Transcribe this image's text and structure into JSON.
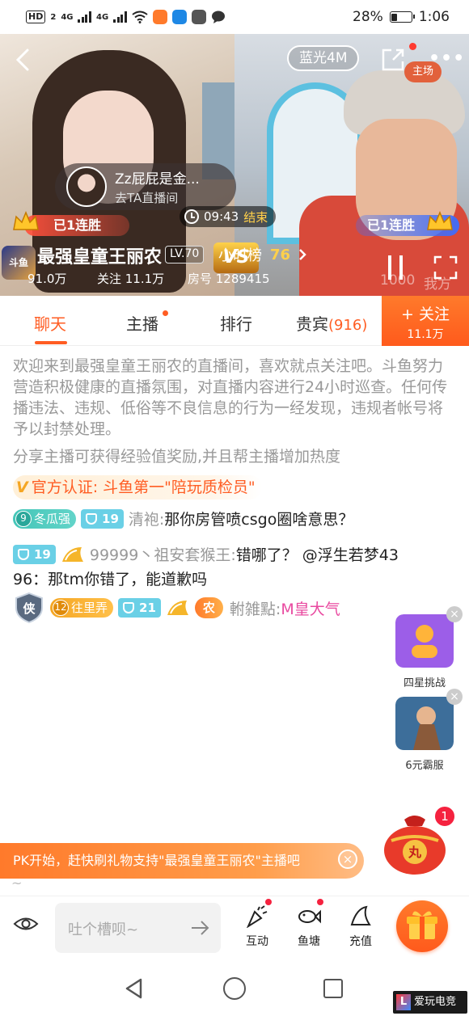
{
  "status_bar": {
    "network_badge": "HD",
    "network_sub": "2",
    "sig1": "4G",
    "sig2": "4G",
    "battery": "28%",
    "time": "1:06"
  },
  "video": {
    "quality": "蓝光4M",
    "host_badge": "主场",
    "guest_name": "Zz屁屁是金...",
    "guest_sub": "去TA直播间",
    "pk_time": "09:43",
    "pk_state": "结束",
    "streak_left": "已1连胜",
    "streak_right": "已1连胜",
    "vs": "VS",
    "logo_text": "斗鱼",
    "anchor_name": "最强皇童王丽农",
    "level": "LV.70",
    "hour_rank_label": "小时榜",
    "hour_rank_value": "76",
    "fans": "91.0万",
    "follow_label": "关注 11.1万",
    "room_label": "房号 1289415",
    "right_count": "1000",
    "right_me": "我方"
  },
  "tabs": {
    "chat": "聊天",
    "anchor": "主播",
    "rank": "排行",
    "vip": "贵宾",
    "vip_count": "(916)"
  },
  "follow_button": {
    "label": "+ 关注",
    "count": "11.1万"
  },
  "chat": {
    "welcome": "欢迎来到最强皇童王丽农的直播间，喜欢就点关注吧。斗鱼努力营造积极健康的直播氛围，对直播内容进行24小时巡查。任何传播违法、违规、低俗等不良信息的行为一经发现，违规者帐号将予以封禁处理。",
    "share_note": "分享主播可获得经验值奖励,并且帮主播增加热度",
    "official_v": "V",
    "official": "官方认证: 斗鱼第一\"陪玩质检员\"",
    "messages": [
      {
        "fan_level": "9",
        "fan_name": "冬瓜强",
        "user_level": "19",
        "user": "清袍:",
        "text": "那你房管喷csgo圈啥意思？"
      },
      {
        "user_level": "19",
        "user": "99999丶祖安套猴王:",
        "text_line1": "错哪了？ @浮生若梦43",
        "text_line2": "96：那tm你错了，能道歉吗"
      },
      {
        "rank_char": "侠",
        "fan_level": "12",
        "fan_name": "往里弄",
        "user_level": "21",
        "nong": "农",
        "user": "軵雑點:",
        "text": "M皇大气"
      }
    ]
  },
  "side_cards": [
    {
      "label": "四星挑战"
    },
    {
      "label": "6元霸服"
    }
  ],
  "pk_banner": {
    "text": "PK开始，赶快刷礼物支持\"最强皇童王丽农\"主播吧",
    "close": "×",
    "tilde": "~"
  },
  "lucky_bag": {
    "count": "1",
    "char": "丸"
  },
  "bottom_bar": {
    "input_placeholder": "吐个槽呗~",
    "tool_interact": "互动",
    "tool_pond": "鱼塘",
    "tool_recharge": "充值"
  },
  "watermark": {
    "logo": "L",
    "text": "爱玩电竞"
  },
  "colors": {
    "accent": "#ff5d23",
    "pink": "#e94aa0",
    "gold": "#ffd04a"
  }
}
